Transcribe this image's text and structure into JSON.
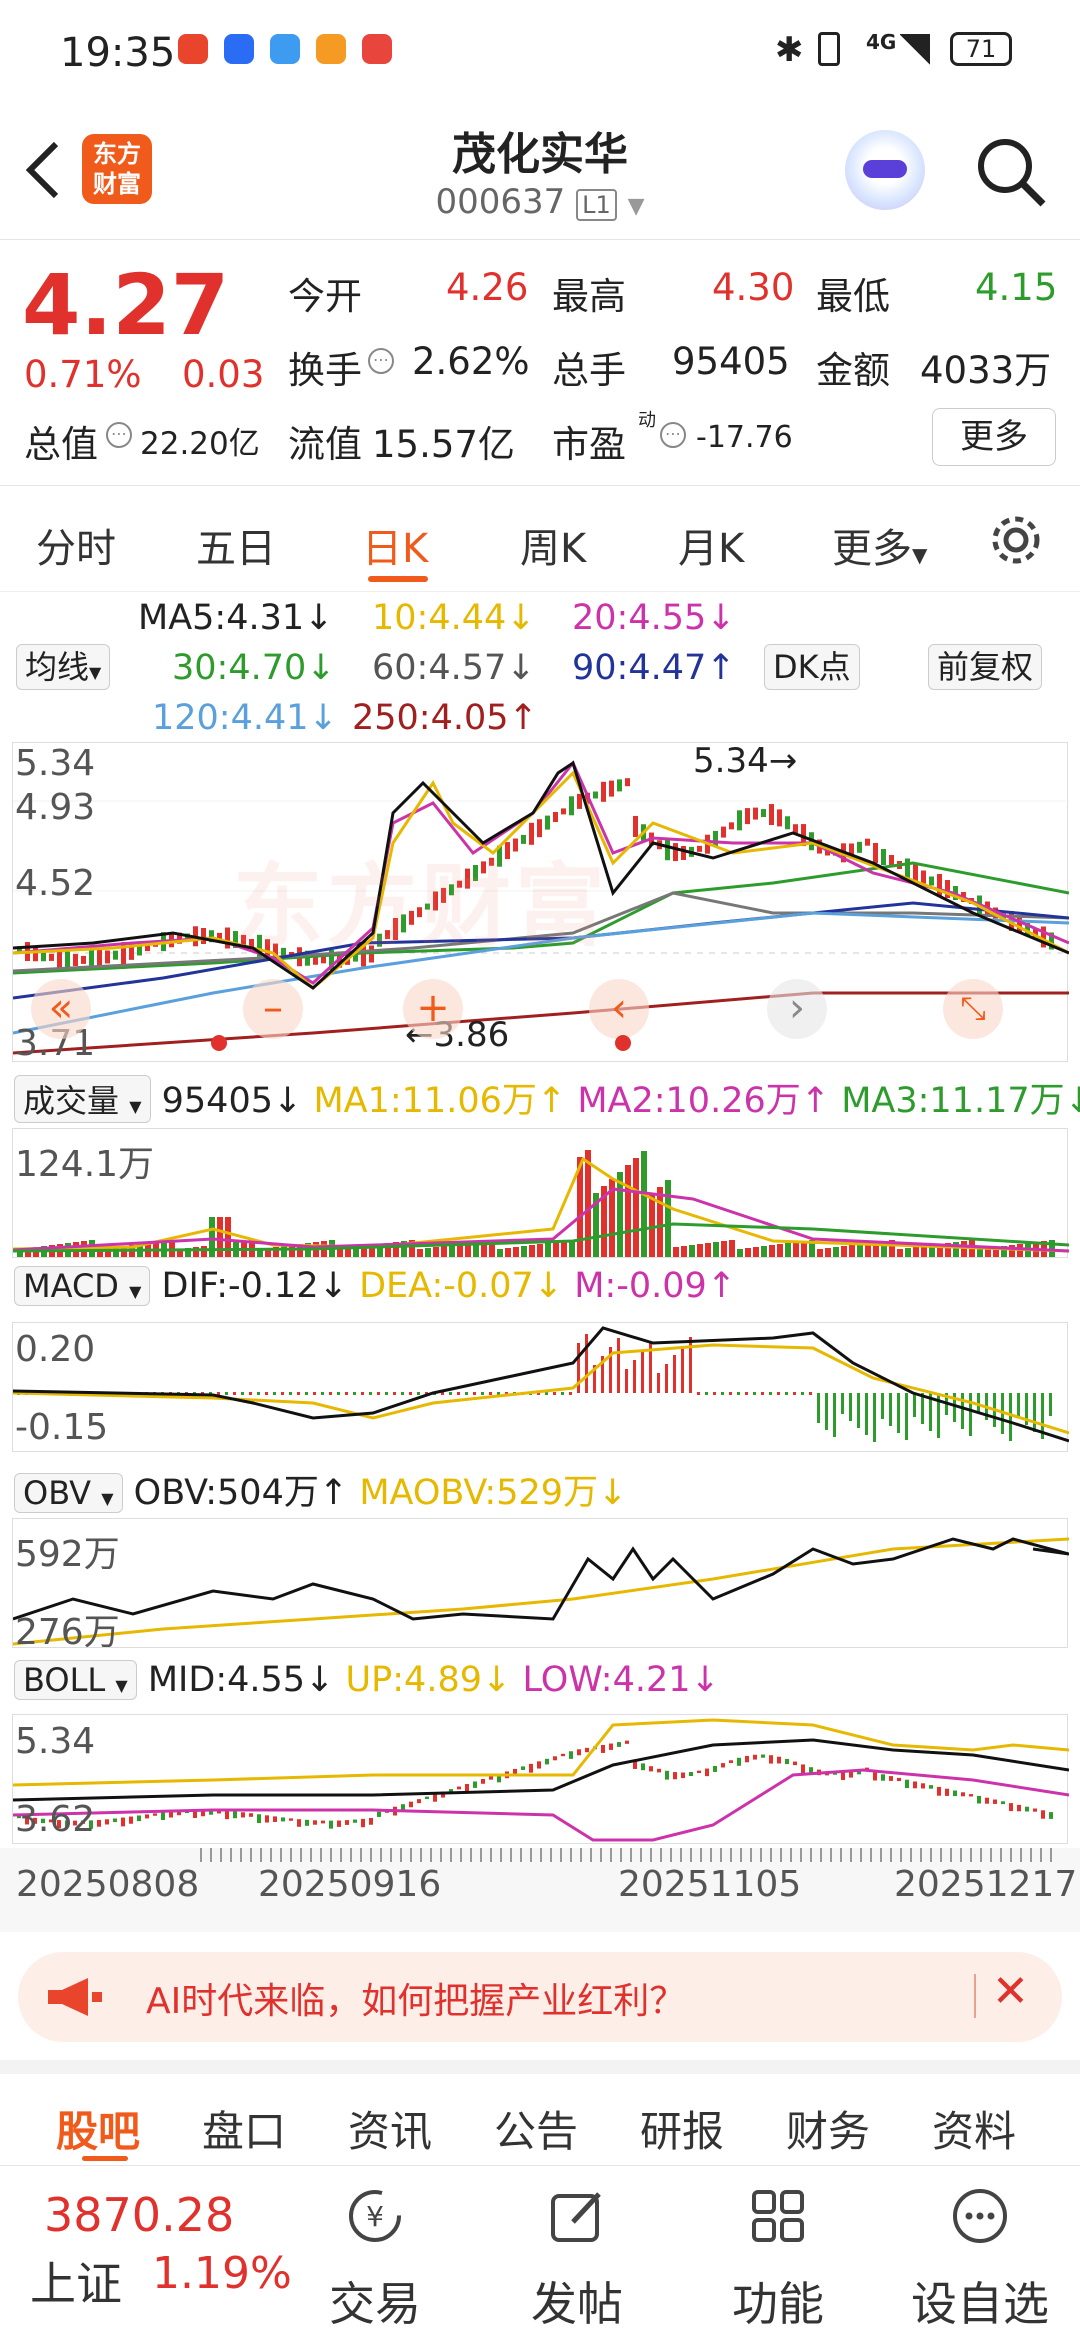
{
  "status_bar": {
    "time": "19:35",
    "network": "4G",
    "battery": "71"
  },
  "header": {
    "brand_logo_text": "东方财富",
    "stock_name": "茂化实华",
    "stock_code": "000637",
    "level_badge": "L1"
  },
  "quote": {
    "price": "4.27",
    "change_pct": "0.71%",
    "change_amt": "0.03",
    "open_label": "今开",
    "open": "4.26",
    "high_label": "最高",
    "high": "4.30",
    "low_label": "最低",
    "low": "4.15",
    "turnover_label": "换手",
    "turnover": "2.62%",
    "volume_label": "总手",
    "volume": "95405",
    "amount_label": "金额",
    "amount": "4033万",
    "total_mv_label": "总值",
    "total_mv": "22.20亿",
    "float_mv_label": "流值",
    "float_mv": "15.57亿",
    "pe_label": "市盈",
    "pe_sup": "动",
    "pe": "-17.76",
    "more_button": "更多"
  },
  "period_tabs": [
    "分时",
    "五日",
    "日K",
    "周K",
    "月K",
    "更多"
  ],
  "active_period": "日K",
  "ma_legend": {
    "type_button": "均线",
    "ma5": "MA5:4.31↓",
    "ma10": "10:4.44↓",
    "ma20": "20:4.55↓",
    "ma30": "30:4.70↓",
    "ma60": "60:4.57↓",
    "ma90": "90:4.47↑",
    "ma120": "120:4.41↓",
    "ma250": "250:4.05↑",
    "dk_button": "DK点",
    "adjust_button": "前复权"
  },
  "kline": {
    "y_max": "5.34",
    "y_2": "4.93",
    "y_3": "4.52",
    "y_min": "3.71",
    "high_marker": "5.34",
    "low_marker": "3.86",
    "watermark": "东方财富"
  },
  "volume_panel": {
    "select": "成交量",
    "value": "95405↓",
    "ma1": "MA1:11.06万↑",
    "ma2": "MA2:10.26万↑",
    "ma3": "MA3:11.17万↓",
    "y_max": "124.1万"
  },
  "macd_panel": {
    "select": "MACD",
    "dif": "DIF:-0.12↓",
    "dea": "DEA:-0.07↓",
    "m": "M:-0.09↑",
    "y_max": "0.20",
    "y_min": "-0.15"
  },
  "obv_panel": {
    "select": "OBV",
    "obv": "OBV:504万↑",
    "maobv": "MAOBV:529万↓",
    "y_max": "592万",
    "y_min": "276万"
  },
  "boll_panel": {
    "select": "BOLL",
    "mid": "MID:4.55↓",
    "up": "UP:4.89↓",
    "low": "LOW:4.21↓",
    "y_max": "5.34",
    "y_min": "3.62"
  },
  "dates": [
    "20250808",
    "20250916",
    "20251105",
    "20251217"
  ],
  "banner": {
    "text": "AI时代来临，如何把握产业红利？"
  },
  "sub_tabs": [
    "股吧",
    "盘口",
    "资讯",
    "公告",
    "研报",
    "财务",
    "资料"
  ],
  "active_sub_tab": "股吧",
  "bottom_bar": {
    "index_value": "3870.28",
    "index_name": "上证",
    "index_change": "1.19%",
    "trade": "交易",
    "post": "发帖",
    "function": "功能",
    "watchlist": "设自选"
  },
  "colors": {
    "up": "#e0312c",
    "down": "#2d9c2d",
    "brand": "#f05a1a",
    "ma5": "#111111",
    "ma10": "#e6b800",
    "ma20": "#cc33aa",
    "ma30": "#2d9c2d",
    "ma60": "#777777",
    "ma90": "#223399",
    "ma120": "#5aa0dc",
    "ma250": "#a02020"
  }
}
